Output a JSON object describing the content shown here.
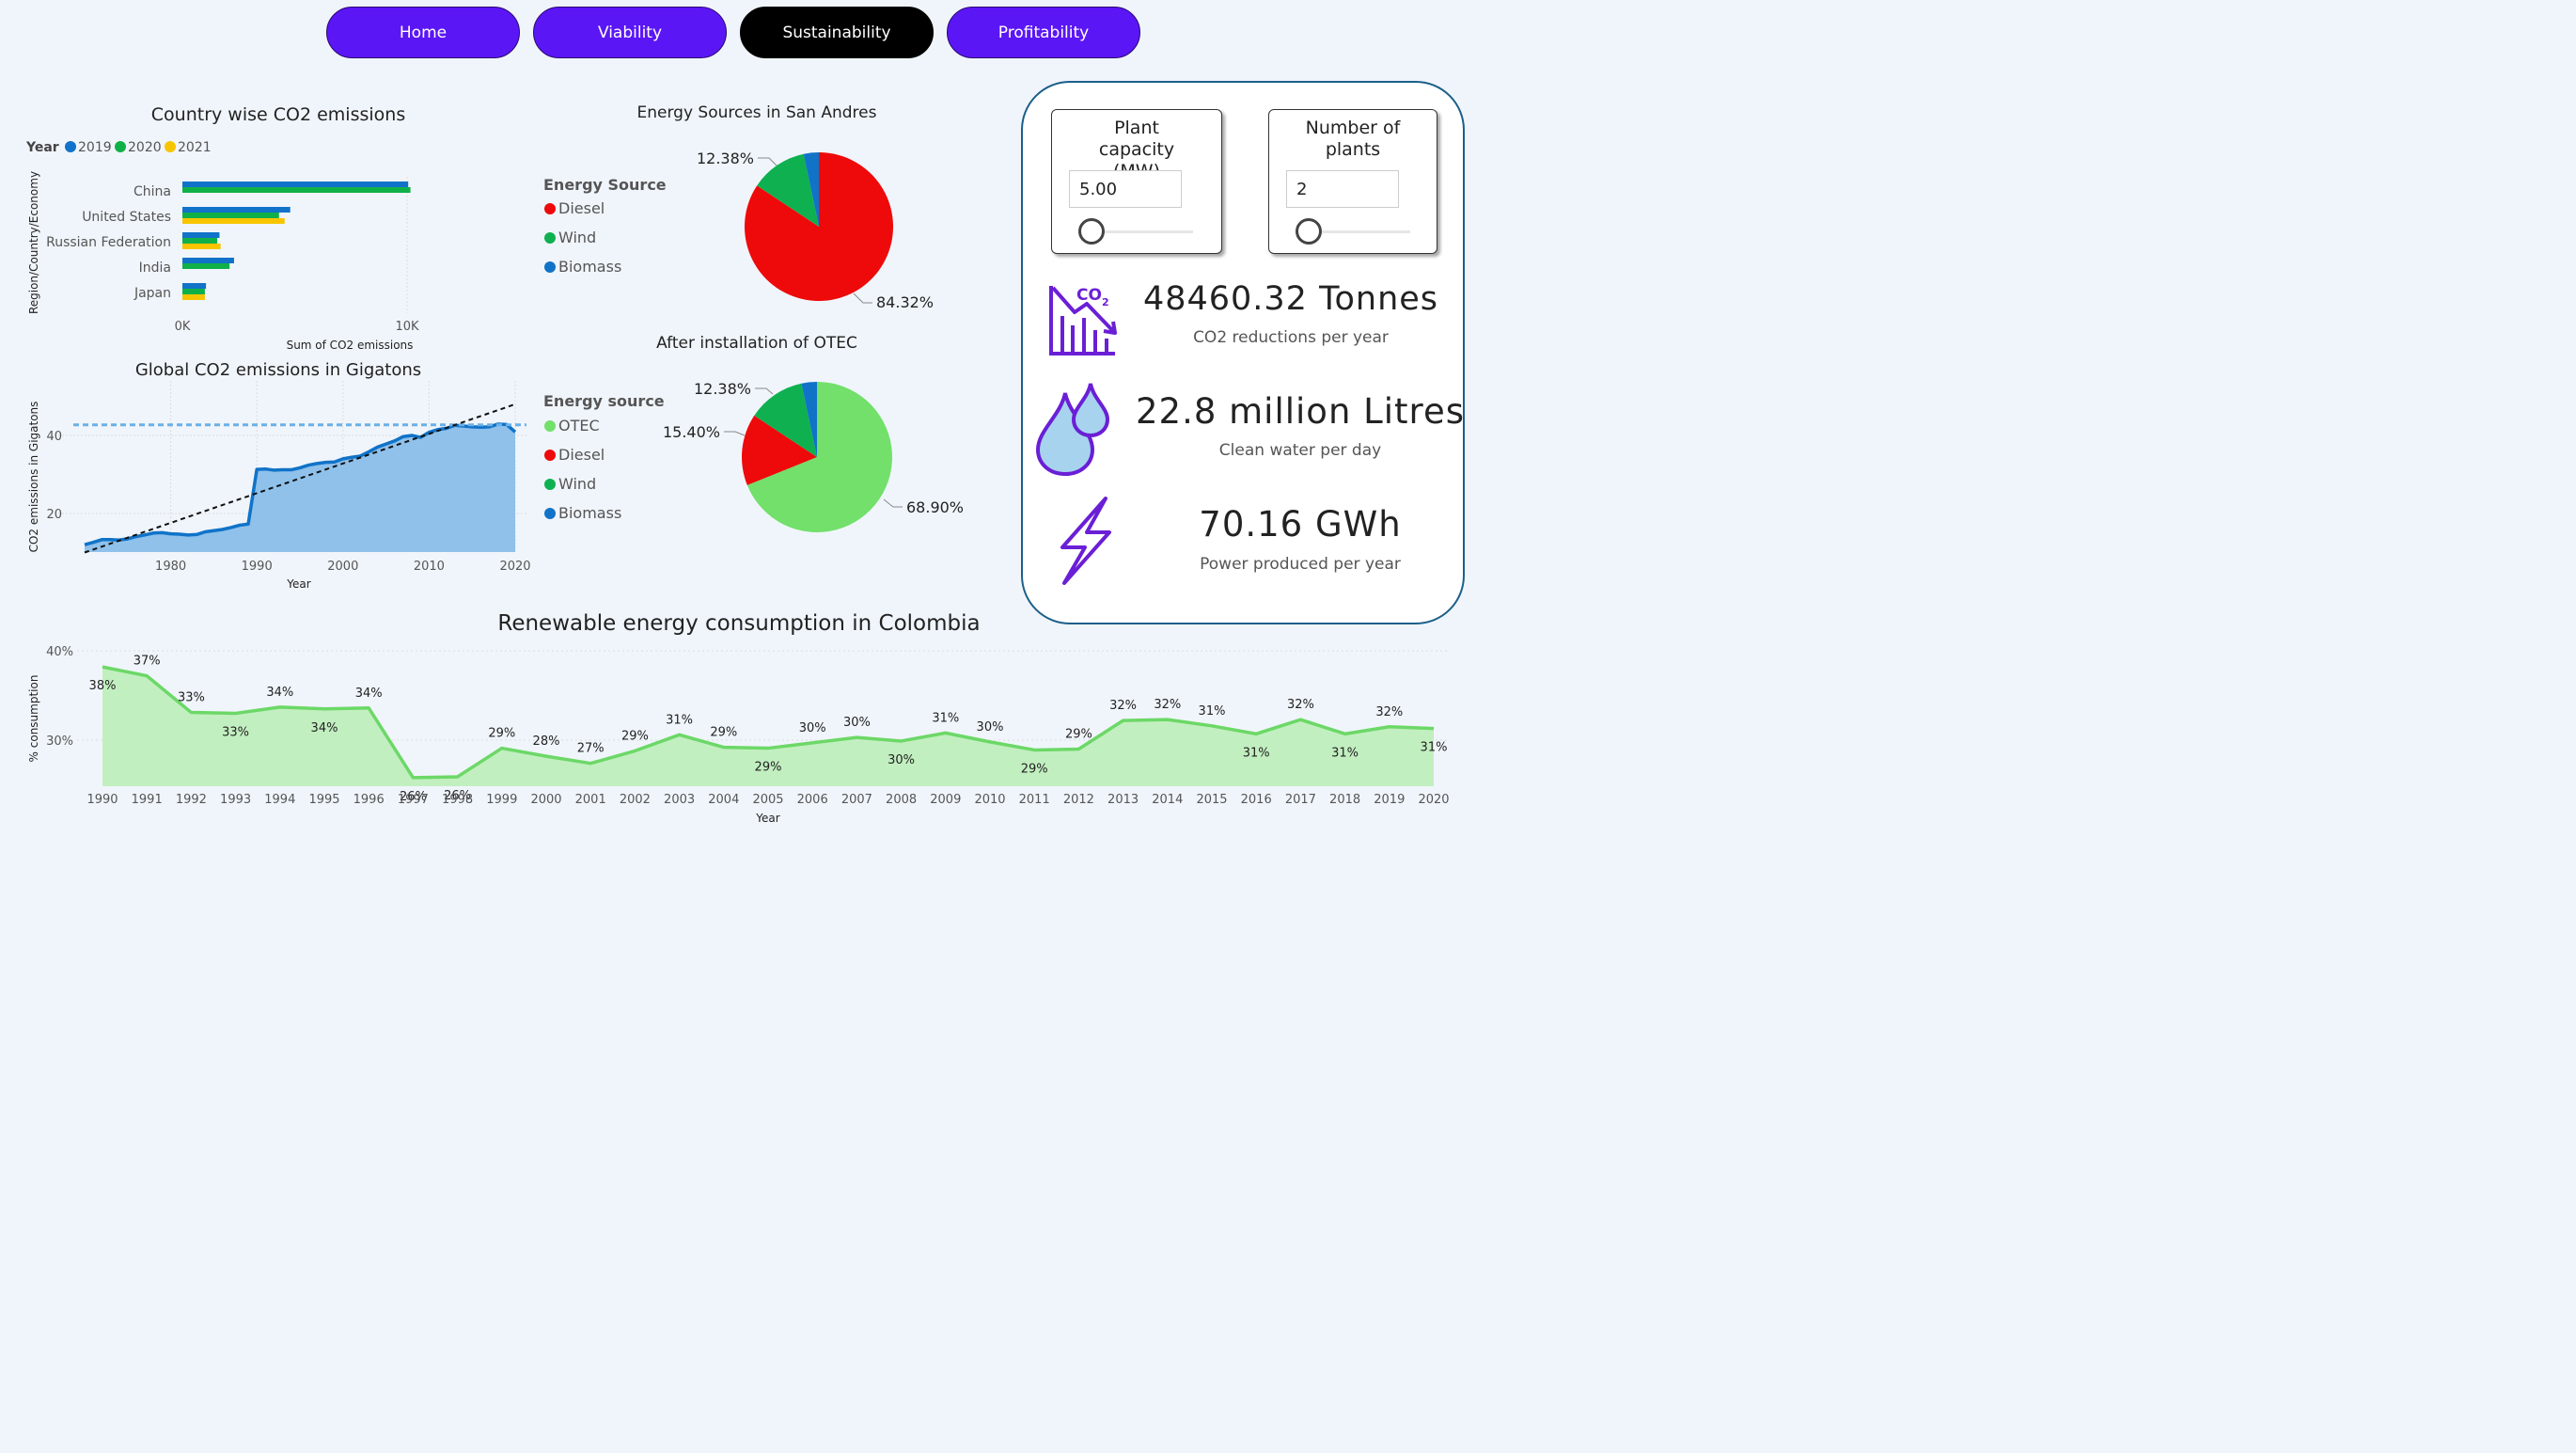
{
  "nav": {
    "home": "Home",
    "viability": "Viability",
    "sustainability": "Sustainability",
    "profitability": "Profitability"
  },
  "country_chart": {
    "title": "Country wise CO2 emissions",
    "legend_title": "Year",
    "ylabel": "Region/Country/Economy",
    "xlabel": "Sum of CO2 emissions",
    "ticks": [
      "0K",
      "10K"
    ]
  },
  "global_chart": {
    "title": "Global CO2 emissions in Gigatons",
    "ylabel": "CO2 emissions in Gigatons",
    "xlabel": "Year"
  },
  "pie1": {
    "title": "Energy Sources in San Andres",
    "legend_title": "Energy Source"
  },
  "pie2": {
    "title": "After installation of OTEC",
    "legend_title": "Energy source"
  },
  "renewable_chart": {
    "title": "Renewable energy consumption in Colombia",
    "ylabel": "% consumption",
    "xlabel": "Year"
  },
  "kpi": {
    "capacity_title": "Plant capacity (MW)",
    "capacity_value": "5.00",
    "plants_title": "Number of plants",
    "plants_value": "2",
    "co2_value": "48460.32 Tonnes",
    "co2_label": "CO2 reductions per year",
    "co2_icon_text": "CO",
    "co2_icon_sub": "2",
    "water_value": "22.8 million Litres",
    "water_label": "Clean water per day",
    "power_value": "70.16 GWh",
    "power_label": "Power produced per year"
  },
  "colors": {
    "nav": "#5b16f5",
    "nav_active": "#000000",
    "y2019": "#1172c9",
    "y2020": "#10b048",
    "y2021": "#f7c500",
    "diesel": "#ee0a0a",
    "wind": "#0fb050",
    "biomass": "#1073c8",
    "otec": "#72e06a",
    "area_blue": "#8fc1eb",
    "line_blue": "#1073c8",
    "area_green": "#c2efc0",
    "line_green": "#6cd867",
    "icon_purple": "#6a1fd6"
  },
  "chart_data": [
    {
      "type": "bar",
      "title": "Country wise CO2 emissions",
      "xlabel": "Sum of CO2 emissions",
      "ylabel": "Region/Country/Economy",
      "legend_title": "Year",
      "legend_position": "top-left",
      "xlim": [
        0,
        10000
      ],
      "xticks": [
        "0K",
        "10K"
      ],
      "categories": [
        "China",
        "United States",
        "Russian Federation",
        "India",
        "Japan"
      ],
      "series": [
        {
          "name": "2019",
          "values": [
            10050,
            4800,
            1650,
            2300,
            1050
          ]
        },
        {
          "name": "2020",
          "values": [
            10150,
            4300,
            1550,
            2100,
            1000
          ]
        },
        {
          "name": "2021",
          "values": [
            null,
            4550,
            1700,
            null,
            1000
          ]
        }
      ]
    },
    {
      "type": "area",
      "title": "Global CO2 emissions in Gigatons",
      "xlabel": "Year",
      "ylabel": "CO2 emissions in Gigatons",
      "xlim": [
        1970,
        2020
      ],
      "ylim": [
        10,
        45
      ],
      "xticks": [
        1980,
        1990,
        2000,
        2010,
        2020
      ],
      "yticks": [
        20,
        40
      ],
      "grid": true,
      "x": [
        1970,
        1971,
        1972,
        1973,
        1974,
        1975,
        1976,
        1977,
        1978,
        1979,
        1980,
        1981,
        1982,
        1983,
        1984,
        1985,
        1986,
        1987,
        1988,
        1989,
        1990,
        1991,
        1992,
        1993,
        1994,
        1995,
        1996,
        1997,
        1998,
        1999,
        2000,
        2001,
        2002,
        2003,
        2004,
        2005,
        2006,
        2007,
        2008,
        2009,
        2010,
        2011,
        2012,
        2013,
        2014,
        2015,
        2016,
        2017,
        2018,
        2019,
        2020
      ],
      "values": [
        12,
        12.6,
        13.3,
        13.3,
        13.2,
        13.5,
        14.1,
        14.5,
        15,
        15.1,
        14.8,
        14.7,
        14.5,
        14.6,
        15.3,
        15.6,
        15.9,
        16.4,
        17,
        17.3,
        31.3,
        31.4,
        31.1,
        31.2,
        31.2,
        31.7,
        32.4,
        32.8,
        33.1,
        33.2,
        34,
        34.4,
        34.7,
        35.8,
        37,
        37.8,
        38.6,
        39.7,
        40,
        39.5,
        40.8,
        41.5,
        41.8,
        42.6,
        42.4,
        42.2,
        42.1,
        42.2,
        42.9,
        42.8,
        40.9
      ],
      "average": 42.7,
      "trend": [
        [
          1970,
          10
        ],
        [
          2020,
          48
        ]
      ]
    },
    {
      "type": "pie",
      "title": "Energy Sources in San Andres",
      "legend_title": "Energy Source",
      "labels": [
        "Diesel",
        "Wind",
        "Biomass"
      ],
      "values": [
        84.32,
        12.38,
        3.3
      ],
      "data_labels": [
        "84.32%",
        "12.38%"
      ]
    },
    {
      "type": "pie",
      "title": "After installation of OTEC",
      "legend_title": "Energy source",
      "labels": [
        "OTEC",
        "Diesel",
        "Wind",
        "Biomass"
      ],
      "values": [
        68.9,
        15.4,
        12.38,
        3.32
      ],
      "data_labels": [
        "68.90%",
        "15.40%",
        "12.38%"
      ]
    },
    {
      "type": "area",
      "title": "Renewable energy consumption in Colombia",
      "xlabel": "Year",
      "ylabel": "% consumption",
      "xlim": [
        1990,
        2020
      ],
      "ylim": [
        25,
        40
      ],
      "yticks": [
        "30%",
        "40%"
      ],
      "grid": true,
      "x": [
        1990,
        1991,
        1992,
        1993,
        1994,
        1995,
        1996,
        1997,
        1998,
        1999,
        2000,
        2001,
        2002,
        2003,
        2004,
        2005,
        2006,
        2007,
        2008,
        2009,
        2010,
        2011,
        2012,
        2013,
        2014,
        2015,
        2016,
        2017,
        2018,
        2019,
        2020
      ],
      "values": [
        38.2,
        37.2,
        33.1,
        33,
        33.7,
        33.5,
        33.6,
        25.8,
        25.9,
        29.1,
        28.2,
        27.4,
        28.8,
        30.6,
        29.2,
        29.1,
        29.7,
        30.3,
        29.9,
        30.8,
        29.8,
        28.9,
        29,
        32.2,
        32.3,
        31.6,
        30.7,
        32.3,
        30.7,
        31.5,
        31.3
      ],
      "labels": [
        "38%",
        "37%",
        "33%",
        "33%",
        "34%",
        "34%",
        "34%",
        "26%",
        "26%",
        "29%",
        "28%",
        "27%",
        "29%",
        "31%",
        "29%",
        "29%",
        "30%",
        "30%",
        "30%",
        "31%",
        "30%",
        "29%",
        "29%",
        "32%",
        "32%",
        "31%",
        "31%",
        "32%",
        "31%",
        "32%",
        "31%"
      ]
    }
  ]
}
